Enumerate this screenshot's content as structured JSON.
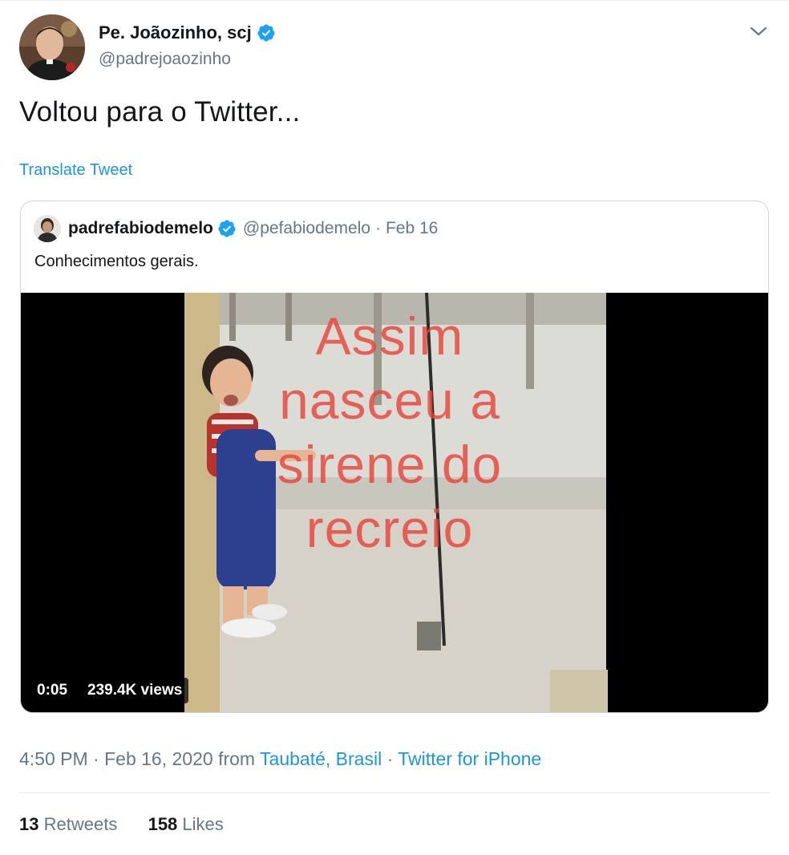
{
  "author": {
    "display_name": "Pe. Joãozinho, scj",
    "handle": "@padrejoaozinho",
    "verified": true
  },
  "tweet": {
    "text": "Voltou para o Twitter...",
    "translate_label": "Translate Tweet"
  },
  "quoted": {
    "display_name": "padrefabiodemelo",
    "handle": "@pefabiodemelo",
    "separator": "·",
    "date": "Feb 16",
    "text": "Conhecimentos gerais.",
    "video": {
      "overlay_lines": [
        "Assim",
        "nasceu a",
        "sirene do",
        "recreio"
      ],
      "duration": "0:05",
      "views": "239.4K views"
    }
  },
  "meta": {
    "time": "4:50 PM",
    "sep1": "·",
    "date": "Feb 16, 2020",
    "from_label": "from",
    "location": "Taubaté, Brasil",
    "sep2": "·",
    "source": "Twitter for iPhone"
  },
  "stats": {
    "retweets_count": "13",
    "retweets_label": "Retweets",
    "likes_count": "158",
    "likes_label": "Likes"
  },
  "colors": {
    "link": "#1b95e0",
    "verified": "#1da1f2",
    "secondary_text": "#657786",
    "overlay_text": "#e8453c"
  },
  "icons": {
    "verified": "verified-badge-icon",
    "caret": "chevron-down-icon"
  }
}
